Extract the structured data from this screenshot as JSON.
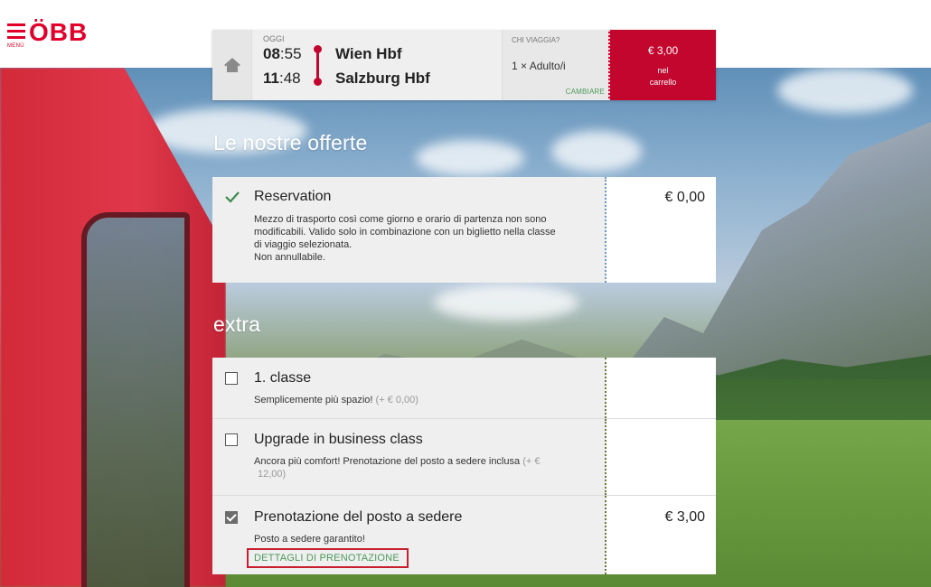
{
  "header": {
    "menu_label": "MENÙ",
    "brand": "ÖBB"
  },
  "journey": {
    "day_label": "OGGI",
    "departure_hour": "08",
    "departure_min": ":55",
    "arrival_hour": "11",
    "arrival_min": ":48",
    "from": "Wien Hbf",
    "to": "Salzburg Hbf",
    "travelers_label": "CHI VIAGGIA?",
    "travelers_value": "1 × Adulto/i",
    "change_label": "CAMBIARE",
    "cart_price": "€ 3,00",
    "cart_note_1": "nel",
    "cart_note_2": "carrello"
  },
  "offers": {
    "title": "Le nostre offerte",
    "reservation": {
      "title": "Reservation",
      "desc_1": "Mezzo di trasporto così come giorno e orario di partenza non sono",
      "desc_2": "modificabili. Valido solo in combinazione con un biglietto nella classe",
      "desc_3": "di viaggio selezionata.",
      "desc_4": "Non annullabile.",
      "price": "€ 0,00"
    }
  },
  "extra": {
    "title": "extra",
    "items": [
      {
        "title": "1. classe",
        "desc": "Semplicemente più spazio!",
        "extra_price": "(+ €  0,00)",
        "checked": false,
        "price": ""
      },
      {
        "title": "Upgrade in business class",
        "desc": "Ancora più comfort! Prenotazione del posto a sedere inclusa",
        "extra_price": "(+ €",
        "extra_price_2": "12,00)",
        "checked": false,
        "price": ""
      },
      {
        "title": "Prenotazione del posto a sedere",
        "desc": "Posto a sedere garantito!",
        "link": "DETTAGLI DI PRENOTAZIONE",
        "checked": true,
        "price": "€  3,00"
      }
    ]
  },
  "colors": {
    "brand_red": "#e2002a",
    "cart_red": "#c3062e",
    "link_green": "#4a9a5a"
  },
  "icons": [
    "menu-icon",
    "home-icon",
    "check-icon",
    "checkbox-icon"
  ]
}
